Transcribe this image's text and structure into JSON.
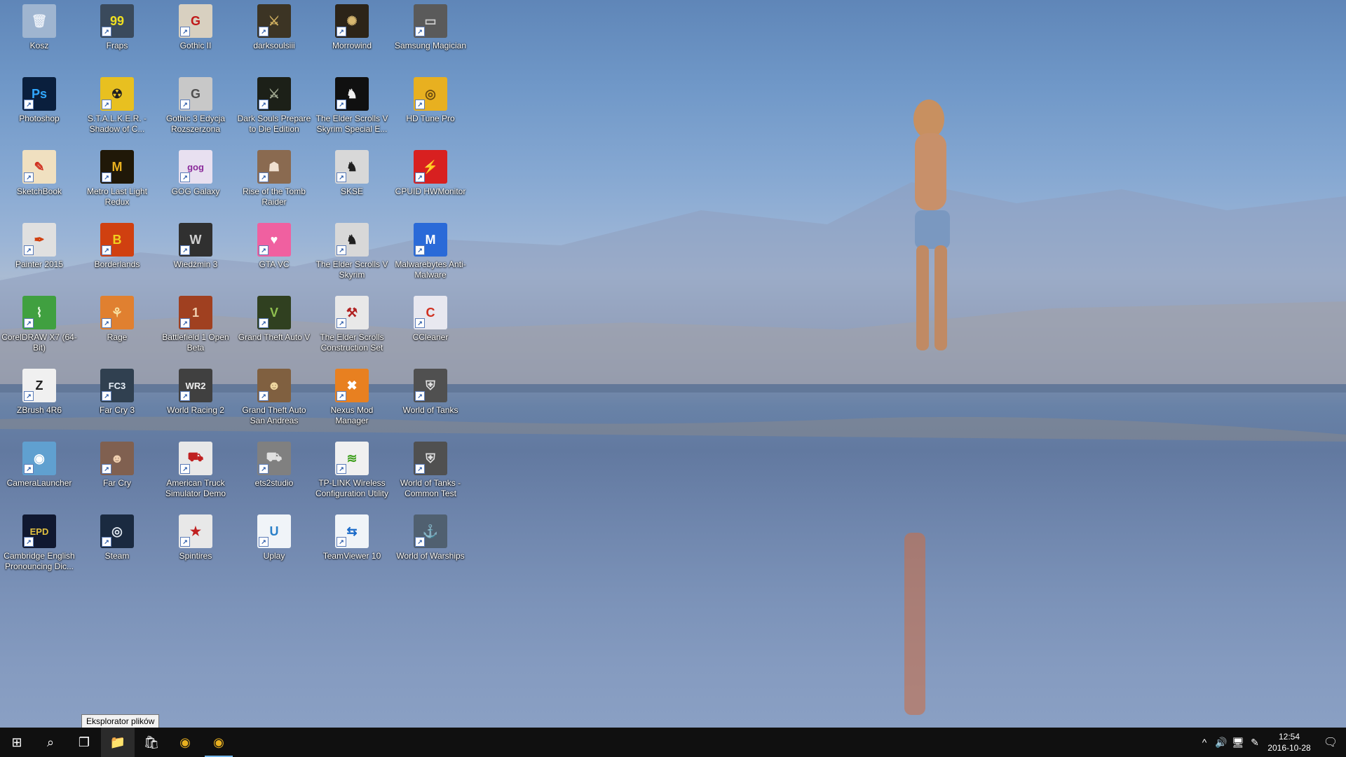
{
  "desktop": {
    "icons": [
      {
        "label": "Kosz",
        "glyph": "🗑",
        "bg": "#9fb5d0",
        "fg": "#e8eef6"
      },
      {
        "label": "Fraps",
        "glyph": "99",
        "bg": "#3a4a5c",
        "fg": "#f0e020"
      },
      {
        "label": "Gothic II",
        "glyph": "G",
        "bg": "#d8d0c0",
        "fg": "#c01818"
      },
      {
        "label": "darksoulsiii",
        "glyph": "⚔",
        "bg": "#3c3424",
        "fg": "#d0b060"
      },
      {
        "label": "Morrowind",
        "glyph": "✺",
        "bg": "#2c2418",
        "fg": "#d8b870"
      },
      {
        "label": "Samsung Magician",
        "glyph": "▭",
        "bg": "#5a5a5a",
        "fg": "#cccccc"
      },
      {
        "label": "Photoshop",
        "glyph": "Ps",
        "bg": "#0a1f3d",
        "fg": "#31a8ff"
      },
      {
        "label": "S.T.A.L.K.E.R. - Shadow of C...",
        "glyph": "☢",
        "bg": "#e8c020",
        "fg": "#202020"
      },
      {
        "label": "Gothic 3 Edycja Rozszerzona",
        "glyph": "G",
        "bg": "#c8c8c8",
        "fg": "#505050"
      },
      {
        "label": "Dark Souls Prepare to Die Edition",
        "glyph": "⚔",
        "bg": "#1c2018",
        "fg": "#a0a890"
      },
      {
        "label": "The Elder Scrolls V Skyrim Special E...",
        "glyph": "♞",
        "bg": "#101010",
        "fg": "#f0f0f0"
      },
      {
        "label": "HD Tune Pro",
        "glyph": "◎",
        "bg": "#e8b020",
        "fg": "#6a4a10"
      },
      {
        "label": "SketchBook",
        "glyph": "✎",
        "bg": "#f0e0c0",
        "fg": "#d03020"
      },
      {
        "label": "Metro Last Light Redux",
        "glyph": "M",
        "bg": "#201808",
        "fg": "#e8b020"
      },
      {
        "label": "GOG Galaxy",
        "glyph": "gog",
        "bg": "#e8e0f0",
        "fg": "#8a2a9a"
      },
      {
        "label": "Rise of the Tomb Raider",
        "glyph": "☗",
        "bg": "#8a6a50",
        "fg": "#f0e0d0"
      },
      {
        "label": "SKSE",
        "glyph": "♞",
        "bg": "#d8d8d8",
        "fg": "#202020"
      },
      {
        "label": "CPUID HWMonitor",
        "glyph": "⚡",
        "bg": "#d82020",
        "fg": "#ffffff"
      },
      {
        "label": "Painter 2015",
        "glyph": "✒",
        "bg": "#e0e0e0",
        "fg": "#d04010"
      },
      {
        "label": "Borderlands",
        "glyph": "B",
        "bg": "#d04010",
        "fg": "#f0d020"
      },
      {
        "label": "Wiedźmin 3",
        "glyph": "W",
        "bg": "#303030",
        "fg": "#d0d0d0"
      },
      {
        "label": "GTA VC",
        "glyph": "♥",
        "bg": "#f060a0",
        "fg": "#ffffff"
      },
      {
        "label": "The Elder Scrolls V Skyrim",
        "glyph": "♞",
        "bg": "#d8d8d8",
        "fg": "#202020"
      },
      {
        "label": "Malwarebytes Anti-Malware",
        "glyph": "M",
        "bg": "#2a6ad8",
        "fg": "#ffffff"
      },
      {
        "label": "CorelDRAW X7 (64-Bit)",
        "glyph": "⌇",
        "bg": "#40a040",
        "fg": "#e8f8e0"
      },
      {
        "label": "Rage",
        "glyph": "⚘",
        "bg": "#e08030",
        "fg": "#f8e0a0"
      },
      {
        "label": "Battlefield 1 Open Beta",
        "glyph": "1",
        "bg": "#a04020",
        "fg": "#f0d0b0"
      },
      {
        "label": "Grand Theft Auto V",
        "glyph": "V",
        "bg": "#304020",
        "fg": "#90c050"
      },
      {
        "label": "The Elder Scrolls Construction Set",
        "glyph": "⚒",
        "bg": "#e8e8e8",
        "fg": "#b02020"
      },
      {
        "label": "CCleaner",
        "glyph": "C",
        "bg": "#e8e8f0",
        "fg": "#d03020"
      },
      {
        "label": "ZBrush 4R6",
        "glyph": "Z",
        "bg": "#f0f0f0",
        "fg": "#202020"
      },
      {
        "label": "Far Cry 3",
        "glyph": "FC3",
        "bg": "#304050",
        "fg": "#e8f0f8"
      },
      {
        "label": "World Racing 2",
        "glyph": "WR2",
        "bg": "#404040",
        "fg": "#f0f0f0"
      },
      {
        "label": "Grand Theft Auto San Andreas",
        "glyph": "☻",
        "bg": "#806040",
        "fg": "#f0d8a0"
      },
      {
        "label": "Nexus Mod Manager",
        "glyph": "✖",
        "bg": "#e88020",
        "fg": "#ffffff"
      },
      {
        "label": "World of Tanks",
        "glyph": "⛨",
        "bg": "#505050",
        "fg": "#e0e0e0"
      },
      {
        "label": "CameraLauncher",
        "glyph": "◉",
        "bg": "#60a0d0",
        "fg": "#ffffff"
      },
      {
        "label": "Far Cry",
        "glyph": "☻",
        "bg": "#806050",
        "fg": "#f0d0b0"
      },
      {
        "label": "American Truck Simulator Demo",
        "glyph": "⛟",
        "bg": "#e8e8e8",
        "fg": "#c02020"
      },
      {
        "label": "ets2studio",
        "glyph": "⛟",
        "bg": "#808080",
        "fg": "#e0e0e0"
      },
      {
        "label": "TP-LINK Wireless Configuration Utility",
        "glyph": "≋",
        "bg": "#f0f0f0",
        "fg": "#40a020"
      },
      {
        "label": "World of Tanks - Common Test",
        "glyph": "⛨",
        "bg": "#505050",
        "fg": "#e0e0e0"
      },
      {
        "label": "Cambridge English Pronouncing Dic...",
        "glyph": "EPD",
        "bg": "#101830",
        "fg": "#e0c040"
      },
      {
        "label": "Steam",
        "glyph": "◎",
        "bg": "#1a2a40",
        "fg": "#e0e8f0"
      },
      {
        "label": "Spintires",
        "glyph": "★",
        "bg": "#e8e8e8",
        "fg": "#c02020"
      },
      {
        "label": "Uplay",
        "glyph": "U",
        "bg": "#f0f4f8",
        "fg": "#2a80c8"
      },
      {
        "label": "TeamViewer 10",
        "glyph": "⇆",
        "bg": "#f0f4f8",
        "fg": "#1a6ac8"
      },
      {
        "label": "World of Warships",
        "glyph": "⚓",
        "bg": "#506070",
        "fg": "#e0e8f0"
      }
    ]
  },
  "tooltip": {
    "text": "Eksplorator plików"
  },
  "taskbar": {
    "start_glyph": "⊞",
    "search_glyph": "⌕",
    "taskview_glyph": "❐",
    "explorer_glyph": "📁",
    "store_glyph": "🛍",
    "chrome_glyph": "◉",
    "chrome2_glyph": "◉"
  },
  "tray": {
    "chevron": "^",
    "volume": "🔊",
    "network": "🖥",
    "pen": "✎",
    "time": "12:54",
    "date": "2016-10-28",
    "notifications": "🗨"
  }
}
